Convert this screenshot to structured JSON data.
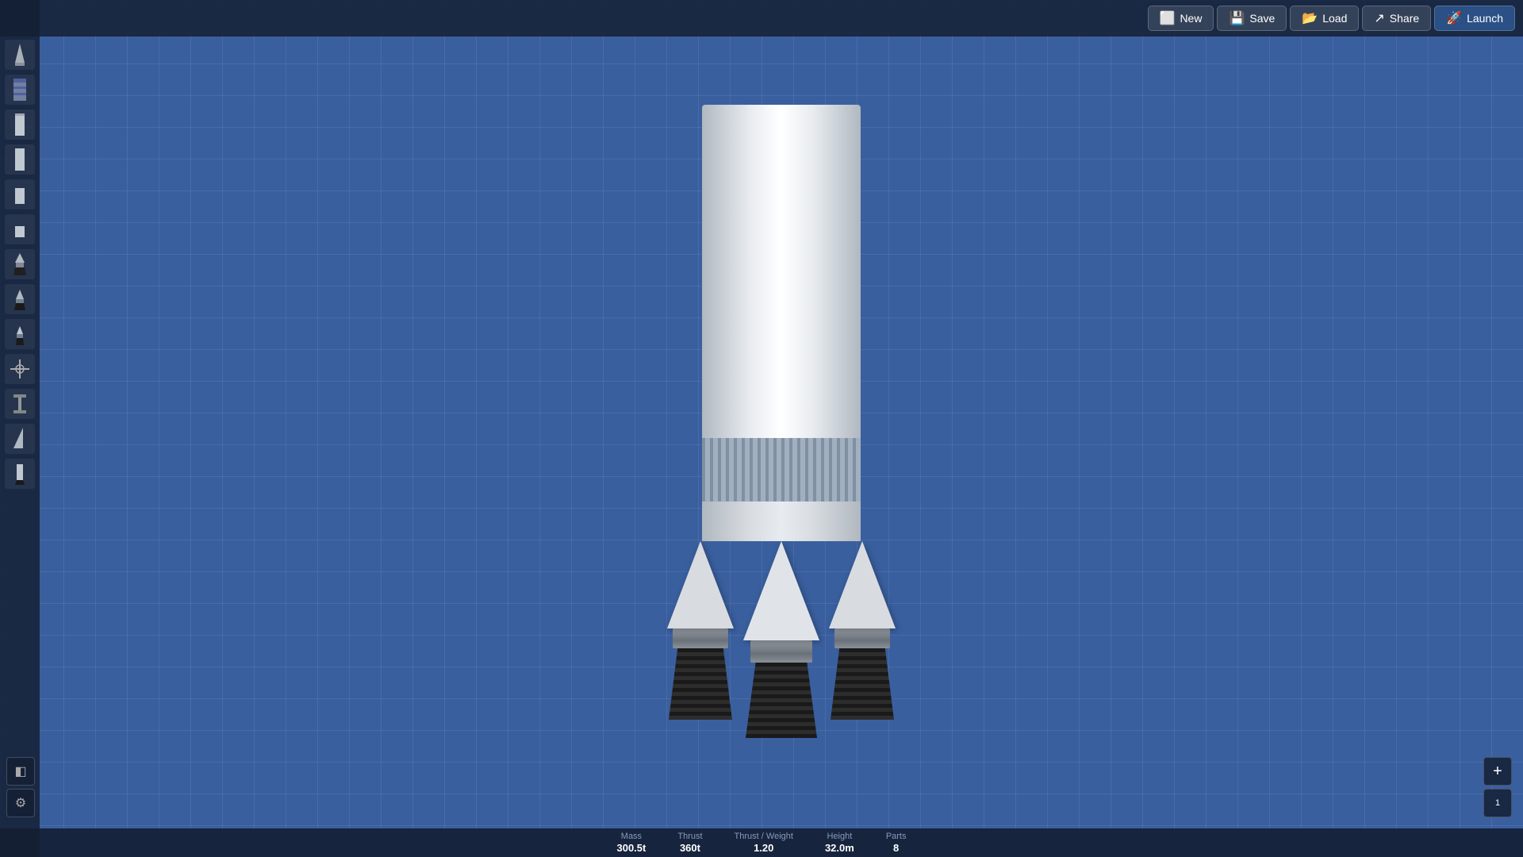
{
  "toolbar": {
    "new_label": "New",
    "save_label": "Save",
    "load_label": "Load",
    "share_label": "Share",
    "launch_label": "Launch"
  },
  "stats": {
    "mass_label": "Mass",
    "mass_value": "300.5t",
    "thrust_label": "Thrust",
    "thrust_value": "360t",
    "tw_label": "Thrust / Weight",
    "tw_value": "1.20",
    "height_label": "Height",
    "height_value": "32.0m",
    "parts_label": "Parts",
    "parts_value": "8"
  },
  "zoom": {
    "level": "1"
  },
  "sidebar": {
    "parts": [
      {
        "name": "nose-cone",
        "label": "Nose Cone"
      },
      {
        "name": "fuel-tank-striped",
        "label": "Fuel Tank"
      },
      {
        "name": "fuel-tank-1",
        "label": "Fuel Tank"
      },
      {
        "name": "fuel-tank-2",
        "label": "Fuel Tank"
      },
      {
        "name": "fuel-tank-3",
        "label": "Fuel Tank"
      },
      {
        "name": "fuel-tank-4",
        "label": "Fuel Tank"
      },
      {
        "name": "engine-1",
        "label": "Engine"
      },
      {
        "name": "engine-2",
        "label": "Engine"
      },
      {
        "name": "engine-3",
        "label": "Engine"
      },
      {
        "name": "separator",
        "label": "Separator"
      },
      {
        "name": "strut",
        "label": "Strut"
      },
      {
        "name": "fin",
        "label": "Fin"
      },
      {
        "name": "booster",
        "label": "Booster"
      }
    ]
  }
}
